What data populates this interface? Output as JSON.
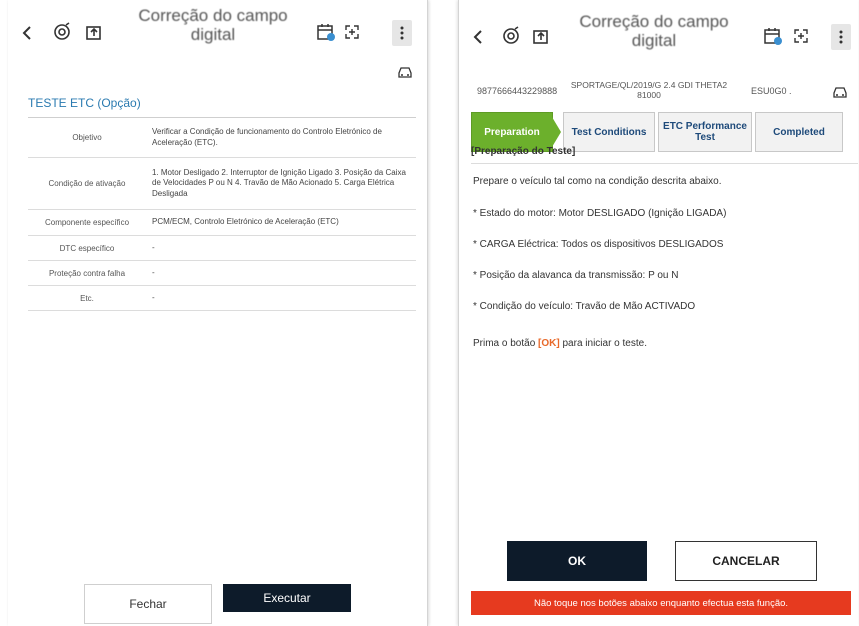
{
  "header": {
    "title_line1": "Correção do campo",
    "title_line2": "digital"
  },
  "left": {
    "section_title": "TESTE ETC (Opção)",
    "rows": [
      {
        "key": "Objetivo",
        "value": "Verificar a Condição de funcionamento do Controlo Eletrónico de Aceleração (ETC)."
      },
      {
        "key": "Condição de ativação",
        "value": "1. Motor Desligado 2. Interruptor de Ignição Ligado 3. Posição da Caixa de Velocidades P ou N 4. Travão de Mão Acionado 5. Carga Elétrica Desligada"
      },
      {
        "key": "Componente específico",
        "value": "PCM/ECM, Controlo Eletrónico de Aceleração (ETC)"
      },
      {
        "key": "DTC específico",
        "value": "-"
      },
      {
        "key": "Proteção contra falha",
        "value": "-"
      },
      {
        "key": "Etc.",
        "value": "-"
      }
    ],
    "close_label": "Fechar",
    "run_label": "Executar"
  },
  "right": {
    "vin": "9877666443229888",
    "model_line1": "SPORTAGE/QL/2019/G 2.4 GDI THETA2",
    "model_line2": "81000",
    "engine": "ESU0G0 .",
    "tabs": [
      {
        "label": "Preparation",
        "active": true
      },
      {
        "label": "Test Conditions",
        "active": false
      },
      {
        "label": "ETC Performance Test",
        "active": false
      },
      {
        "label": "Completed",
        "active": false
      }
    ],
    "prep_title": "[Preparação do Teste]",
    "intro": "Prepare o veículo tal como na condição descrita abaixo.",
    "lines": [
      "* Estado do motor: Motor DESLIGADO (Ignição LIGADA)",
      "* CARGA Eléctrica: Todos os dispositivos DESLIGADOS",
      "* Posição da alavanca da transmissão: P ou N",
      "* Condição do veículo: Travão de Mão ACTIVADO"
    ],
    "press_before": "Prima o botão ",
    "press_ok": "[OK]",
    "press_after": " para iniciar o teste.",
    "ok_label": "OK",
    "cancel_label": "CANCELAR",
    "warning": "Não toque nos botões abaixo enquanto efectua esta função."
  },
  "colors": {
    "accent_green": "#6cb02c",
    "dark_button": "#0d1b2a",
    "warning_red": "#e63a1f",
    "link_blue": "#2a7ab0",
    "ok_orange": "#e8692a"
  }
}
